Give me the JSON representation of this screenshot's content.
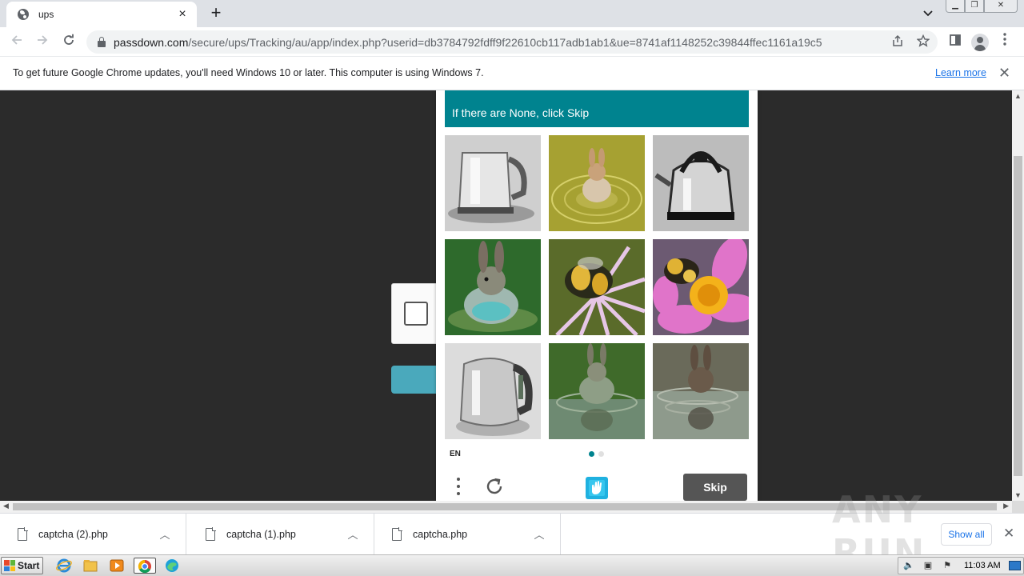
{
  "browser": {
    "tab": {
      "title": "ups"
    },
    "url": {
      "host": "passdown.com",
      "path": "/secure/ups/Tracking/au/app/index.php?userid=db3784792fdff9f22610cb117adb1ab1&ue=8741af1148252c39844ffec1161a19c5"
    }
  },
  "infobar": {
    "message": "To get future Google Chrome updates, you'll need Windows 10 or later. This computer is using Windows 7.",
    "link": "Learn more"
  },
  "captcha": {
    "prompt": "If there are None, click Skip",
    "language": "EN",
    "skip_label": "Skip",
    "active_page": 1,
    "page_count": 2,
    "accent_color": "#00838f",
    "tiles": [
      {
        "subject": "kettle"
      },
      {
        "subject": "rabbit"
      },
      {
        "subject": "kettle"
      },
      {
        "subject": "rabbit"
      },
      {
        "subject": "bee"
      },
      {
        "subject": "bee"
      },
      {
        "subject": "kettle"
      },
      {
        "subject": "rabbit"
      },
      {
        "subject": "rabbit"
      }
    ]
  },
  "downloads": {
    "items": [
      {
        "name": "captcha (2).php"
      },
      {
        "name": "captcha (1).php"
      },
      {
        "name": "captcha.php"
      }
    ],
    "show_all": "Show all"
  },
  "watermark": "ANY RUN",
  "taskbar": {
    "start_label": "Start",
    "clock": "11:03 AM"
  }
}
